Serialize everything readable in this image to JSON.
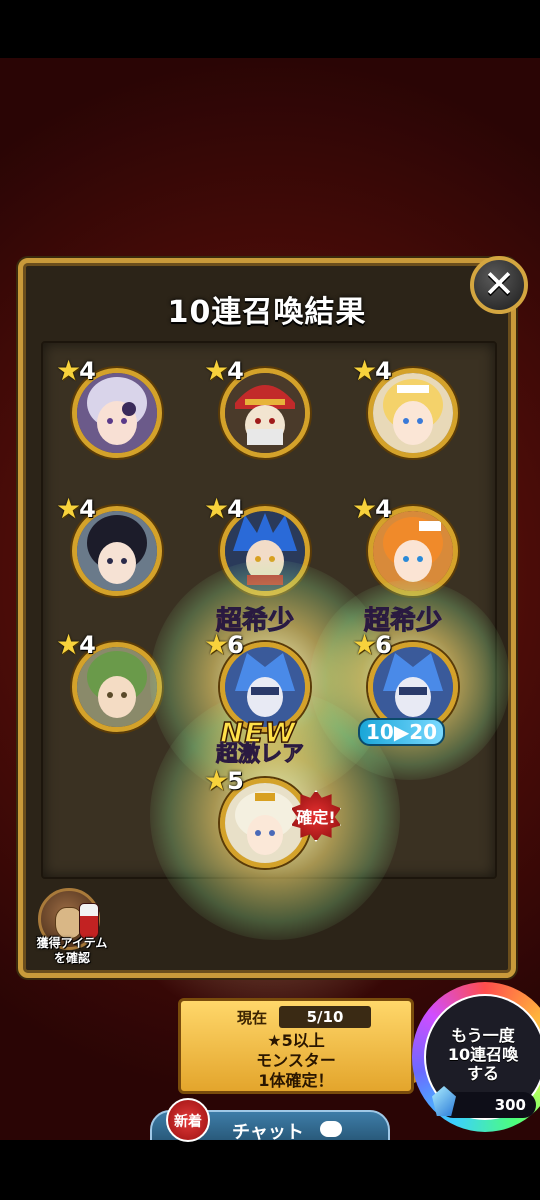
{
  "dialog": {
    "title": "10連召喚結果",
    "close_glyph": "✕"
  },
  "results": [
    {
      "stars": "★",
      "rarity": "4",
      "label": "",
      "tag": ""
    },
    {
      "stars": "★",
      "rarity": "4",
      "label": "",
      "tag": ""
    },
    {
      "stars": "★",
      "rarity": "4",
      "label": "",
      "tag": ""
    },
    {
      "stars": "★",
      "rarity": "4",
      "label": "",
      "tag": ""
    },
    {
      "stars": "★",
      "rarity": "4",
      "label": "",
      "tag": ""
    },
    {
      "stars": "★",
      "rarity": "4",
      "label": "",
      "tag": ""
    },
    {
      "stars": "★",
      "rarity": "4",
      "label": "",
      "tag": ""
    },
    {
      "stars": "★",
      "rarity": "6",
      "label": "超希少",
      "tag": "NEW"
    },
    {
      "stars": "★",
      "rarity": "6",
      "label": "超希少",
      "tag": "10▶20"
    },
    {
      "stars": "★",
      "rarity": "5",
      "label": "超激レア",
      "tag": "確定!"
    }
  ],
  "item_button": {
    "label_line1": "獲得アイテム",
    "label_line2": "を確認"
  },
  "progress": {
    "label": "現在",
    "value": "5/10",
    "line1": "★5以上",
    "line2": "モンスター",
    "line3": "1体確定！"
  },
  "summon_again": {
    "line1": "もう一度",
    "line2": "10連召喚",
    "line3": "する",
    "cost": "300"
  },
  "chat": {
    "label": "チャット",
    "new_badge": "新着"
  },
  "colors": {
    "frame_gold": "#c99a3a",
    "star_yellow": "#f7d23c",
    "background_red": "#7a1d12"
  }
}
